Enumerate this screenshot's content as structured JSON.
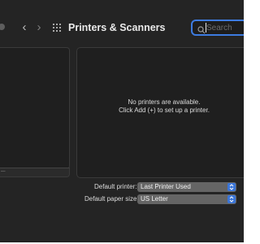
{
  "window": {
    "title": "Printers & Scanners"
  },
  "toolbar": {
    "back_label": "‹",
    "forward_label": "›",
    "grid_icon": "grid-icon",
    "search_placeholder": "Search"
  },
  "printer_list": {
    "remove_label": "–"
  },
  "detail": {
    "empty_line_1": "No printers are available.",
    "empty_line_2": "Click Add (+) to set up a printer."
  },
  "preferences": {
    "default_printer_label": "Default printer:",
    "default_printer_value": "Last Printer Used",
    "default_paper_label": "Default paper size:",
    "default_paper_value": "US Letter"
  },
  "colors": {
    "window_bg": "#242424",
    "accent": "#3a75d8",
    "popup_bg": "#656565"
  }
}
